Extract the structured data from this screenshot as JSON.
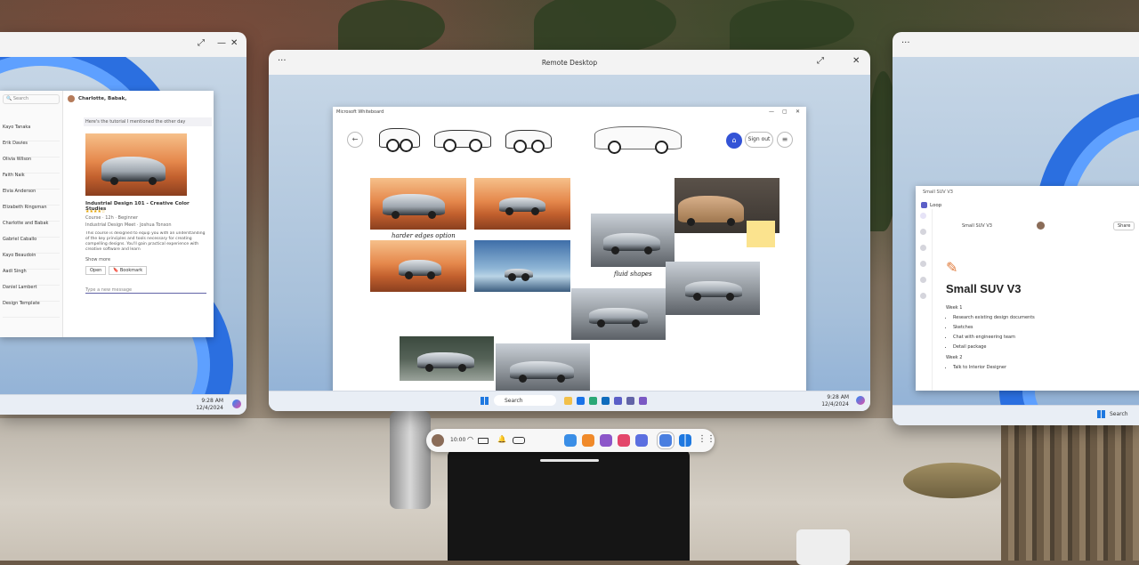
{
  "center_window": {
    "title": "Remote Desktop",
    "menu_icon": "more-icon",
    "fullscreen_icon": "expand-icon",
    "close_icon": "close-icon"
  },
  "whiteboard": {
    "title": "Microsoft Whiteboard",
    "sign_out_label": "Sign out",
    "handwriting_1": "harder edges option",
    "handwriting_2": "fluid shapes",
    "toolbar_icons": [
      "pen-icon",
      "text-icon",
      "shape-icon",
      "image-icon",
      "grid-icon",
      "undo-icon",
      "redo-icon"
    ]
  },
  "center_taskbar": {
    "search_placeholder": "Search",
    "time": "9:28 AM",
    "date": "12/4/2024"
  },
  "dock": {
    "time": "10:00"
  },
  "left_window": {
    "search_placeholder": "Search",
    "thread_name": "Charlotte, Babak,",
    "message_snippet": "Here's the tutorial I mentioned the other day",
    "card_title": "Industrial Design 101 - Creative Color Studies",
    "card_course": "Course · 12h · Beginner",
    "card_org": "Industrial Design Meet · Joshua Tonson",
    "card_desc": "This course is designed to equip you with an understanding of the key principles and tools necessary for creating compelling designs. You'll gain practical experience with creative software and learn",
    "show_more": "Show more",
    "open_label": "Open",
    "bookmark_label": "Bookmark",
    "reply_placeholder": "Type a new message",
    "senders": [
      "Kayo Tanaka",
      "Erik Davies",
      "Olivia Wilson",
      "Faith Naik",
      "Elvia Anderson",
      "Elizabeth Ringsman",
      "Charlotte and Babak",
      "Gabriel Caballo",
      "Kayo Beaudoin",
      "Aadi Singh",
      "Daniel Lambert",
      "Design Template"
    ],
    "taskbar_time": "9:28 AM",
    "taskbar_date": "12/4/2024"
  },
  "right_window": {
    "window_title": "Small SUV V3",
    "app_name": "Loop",
    "breadcrumb": "Small SUV V3",
    "share_label": "Share",
    "doc_title": "Small SUV V3",
    "week1": "Week 1",
    "week1_items": [
      "Research existing design documents",
      "Sketches",
      "Chat with engineering team",
      "Detail package"
    ],
    "week2": "Week 2",
    "week2_items": [
      "Talk to Interior Designer"
    ],
    "taskbar_search": "Search"
  }
}
